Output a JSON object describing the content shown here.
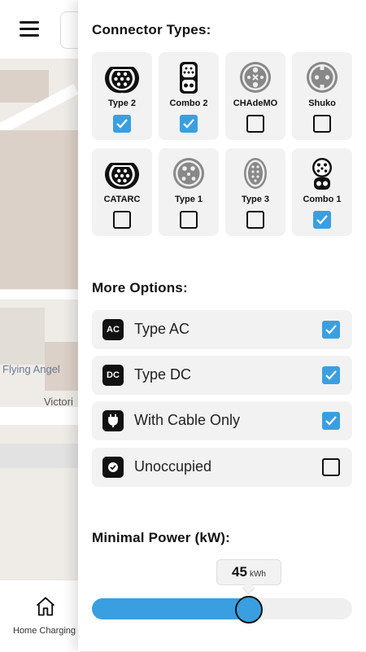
{
  "map": {
    "place_label": "Flying Angel",
    "street_label": "Victori"
  },
  "bottom_nav": {
    "home_label": "Home Charging"
  },
  "connector_section": {
    "title": "Connector Types:",
    "items": [
      {
        "label": "Type 2",
        "icon": "type2-connector-icon",
        "checked": true
      },
      {
        "label": "Combo 2",
        "icon": "combo2-connector-icon",
        "checked": true
      },
      {
        "label": "CHAdeMO",
        "icon": "chademo-connector-icon",
        "checked": false
      },
      {
        "label": "Shuko",
        "icon": "schuko-connector-icon",
        "checked": false
      },
      {
        "label": "CATARC",
        "icon": "catarc-connector-icon",
        "checked": false
      },
      {
        "label": "Type 1",
        "icon": "type1-connector-icon",
        "checked": false
      },
      {
        "label": "Type 3",
        "icon": "type3-connector-icon",
        "checked": false
      },
      {
        "label": "Combo 1",
        "icon": "combo1-connector-icon",
        "checked": true
      }
    ]
  },
  "options_section": {
    "title": "More Options:",
    "items": [
      {
        "label": "Type AC",
        "badge": "AC",
        "icon": "ac-badge-icon",
        "checked": true
      },
      {
        "label": "Type DC",
        "badge": "DC",
        "icon": "dc-badge-icon",
        "checked": true
      },
      {
        "label": "With Cable Only",
        "badge": "",
        "icon": "plug-cable-icon",
        "checked": true
      },
      {
        "label": "Unoccupied",
        "badge": "",
        "icon": "check-circle-icon",
        "checked": false
      }
    ]
  },
  "power_section": {
    "title": "Minimal Power (kW):",
    "value": "45",
    "unit": "kWh",
    "fraction": 0.6
  },
  "colors": {
    "accent": "#3a9fe0",
    "tile_bg": "#f2f2f2"
  }
}
